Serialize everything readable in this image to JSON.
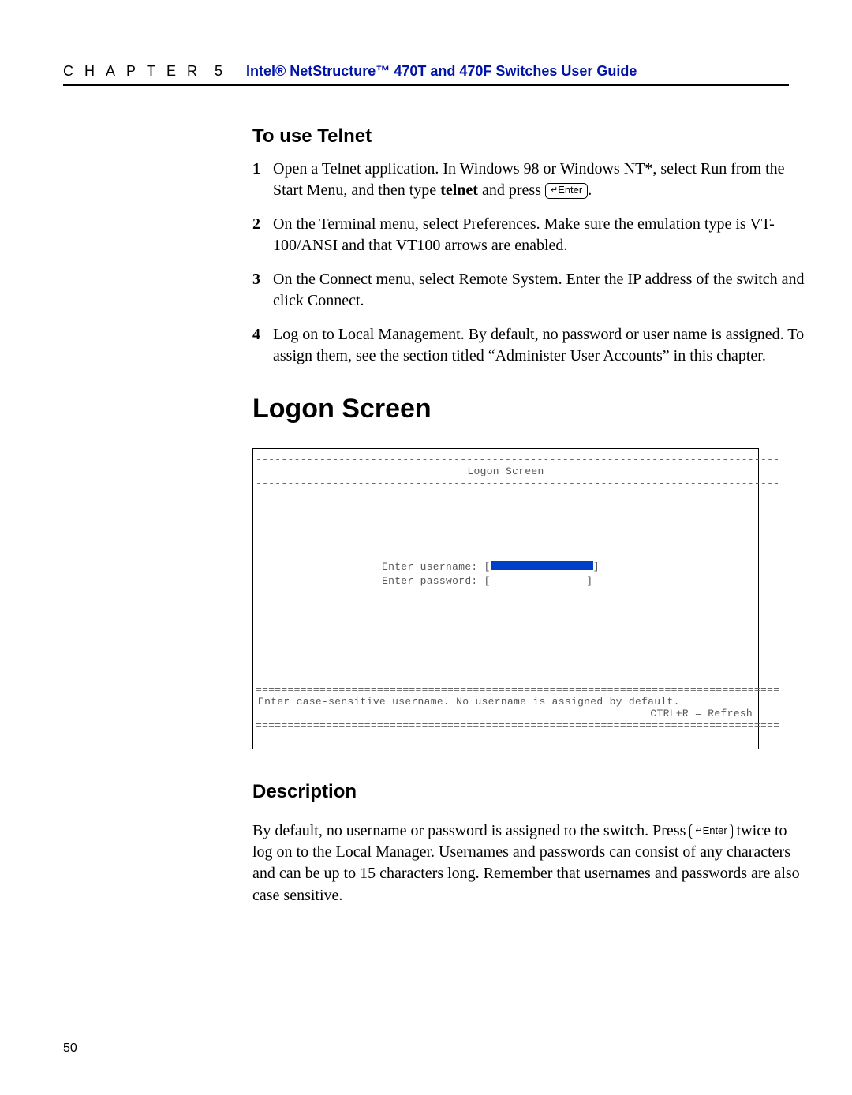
{
  "header": {
    "chapter_label": "CHAPTER",
    "chapter_num": "5",
    "doc_title": "Intel® NetStructure™ 470T and 470F Switches User Guide"
  },
  "sections": {
    "telnet_heading": "To use Telnet",
    "steps": [
      {
        "num": "1",
        "text_a": "Open a Telnet application. In Windows 98 or Windows NT*, select Run from the Start Menu, and then type ",
        "bold": "telnet",
        "text_b": " and press ",
        "key": "Enter",
        "text_c": "."
      },
      {
        "num": "2",
        "text_a": "On the Terminal menu, select Preferences. Make sure the emulation type is VT-100/ANSI and that VT100 arrows are enabled.",
        "bold": "",
        "text_b": "",
        "key": "",
        "text_c": ""
      },
      {
        "num": "3",
        "text_a": "On the Connect menu, select Remote System. Enter the IP address of the switch and click Connect.",
        "bold": "",
        "text_b": "",
        "key": "",
        "text_c": ""
      },
      {
        "num": "4",
        "text_a": "Log on to Local Management. By default, no password or user name is assigned. To assign them, see the section titled “Administer User Accounts” in this chapter.",
        "bold": "",
        "text_b": "",
        "key": "",
        "text_c": ""
      }
    ],
    "logon_heading": "Logon Screen",
    "terminal": {
      "title": "Logon Screen",
      "username_label": "Enter username: [",
      "username_end": "]",
      "password_label": "Enter password: [",
      "password_end": "]",
      "help_line": "Enter case-sensitive username. No username is assigned by default.",
      "refresh_line": "CTRL+R = Refresh"
    },
    "desc_heading": "Description",
    "desc": {
      "p1a": "By default, no username or password is assigned to the switch. Press ",
      "key": "Enter",
      "p1b": " twice to log on to the Local Manager. Usernames and passwords can consist of any characters and can be up to 15 characters long. Remember that usernames and passwords are also case sensitive."
    }
  },
  "page_number": "50"
}
